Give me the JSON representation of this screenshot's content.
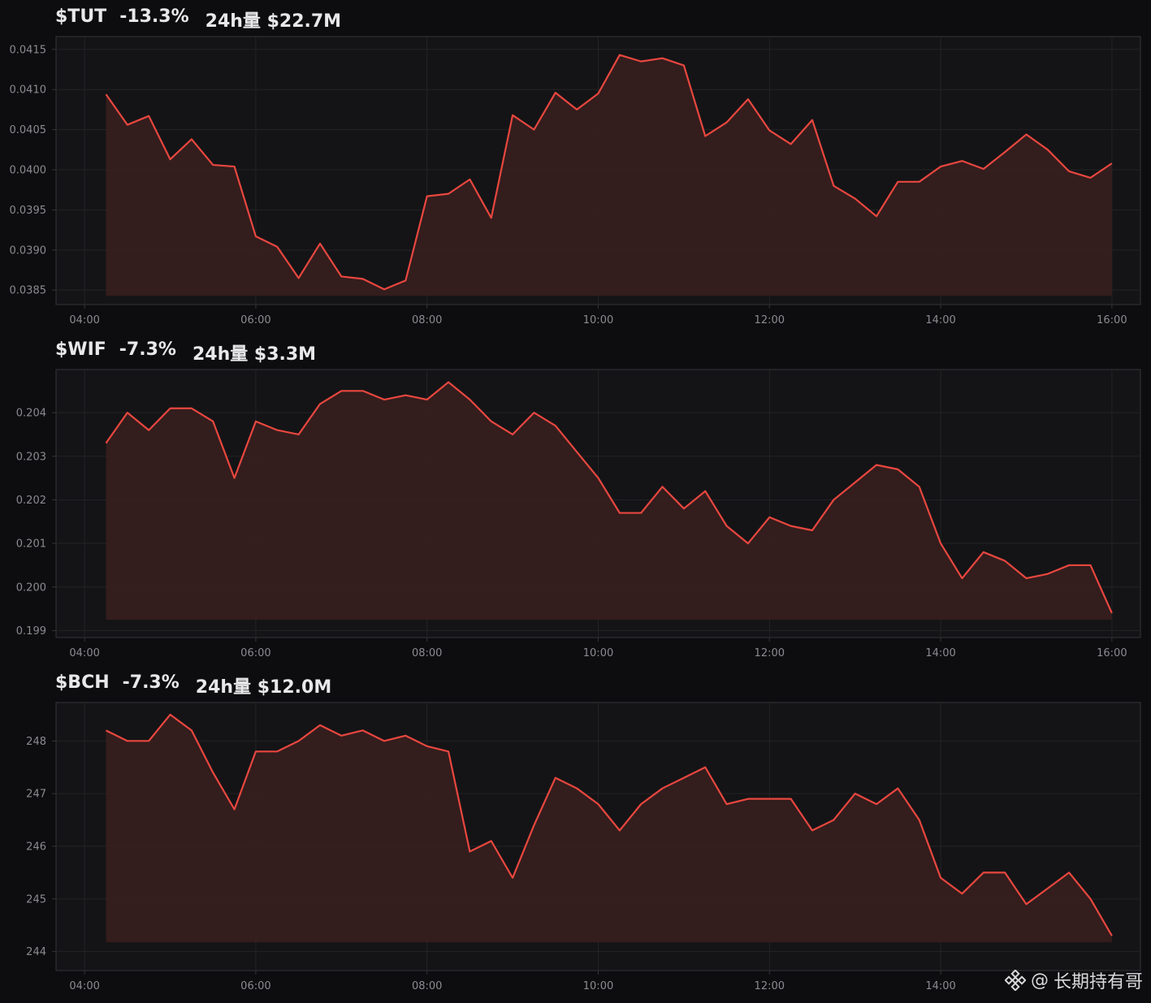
{
  "colors": {
    "line": "#e8473f",
    "fill": "#3a1e1e",
    "plot_bg": "#141416",
    "grid": "#232327",
    "axis": "#35353a",
    "text": "#8b8b90"
  },
  "watermark": {
    "at": "@",
    "text": "长期持有哥",
    "icon": "binance-logo-icon"
  },
  "chart_data": [
    {
      "type": "area",
      "title_symbol": "$TUT",
      "title_change": "-13.3%",
      "title_volume": "24h量 $22.7M",
      "x_ticks": [
        "04:00",
        "06:00",
        "08:00",
        "10:00",
        "12:00",
        "14:00",
        "16:00"
      ],
      "y_ticks": [
        "0.0385",
        "0.0390",
        "0.0395",
        "0.0400",
        "0.0405",
        "0.0410",
        "0.0415"
      ],
      "ylim": [
        0.03832,
        0.04166
      ],
      "xlim": [
        "03:40",
        "16:20"
      ],
      "x": [
        "04:15",
        "04:30",
        "04:45",
        "05:00",
        "05:15",
        "05:30",
        "05:45",
        "06:00",
        "06:15",
        "06:30",
        "06:45",
        "07:00",
        "07:15",
        "07:30",
        "07:45",
        "08:00",
        "08:15",
        "08:30",
        "08:45",
        "09:00",
        "09:15",
        "09:30",
        "09:45",
        "10:00",
        "10:15",
        "10:30",
        "10:45",
        "11:00",
        "11:15",
        "11:30",
        "11:45",
        "12:00",
        "12:15",
        "12:30",
        "12:45",
        "13:00",
        "13:15",
        "13:30",
        "13:45",
        "14:00",
        "14:15",
        "14:30",
        "14:45",
        "15:00",
        "15:15",
        "15:30",
        "15:45",
        "16:00"
      ],
      "values": [
        0.04094,
        0.04056,
        0.04067,
        0.04013,
        0.04038,
        0.04006,
        0.04004,
        0.03917,
        0.03904,
        0.03865,
        0.03908,
        0.03867,
        0.03864,
        0.03851,
        0.03862,
        0.03967,
        0.0397,
        0.03988,
        0.0394,
        0.04068,
        0.0405,
        0.04096,
        0.04075,
        0.04095,
        0.04143,
        0.04135,
        0.04139,
        0.0413,
        0.04042,
        0.04059,
        0.04088,
        0.04049,
        0.04032,
        0.04062,
        0.0398,
        0.03964,
        0.03942,
        0.03985,
        0.03985,
        0.04004,
        0.04011,
        0.04001,
        0.04022,
        0.04044,
        0.04025,
        0.03998,
        0.0399,
        0.04008
      ]
    },
    {
      "type": "area",
      "title_symbol": "$WIF",
      "title_change": "-7.3%",
      "title_volume": "24h量 $3.3M",
      "x_ticks": [
        "04:00",
        "06:00",
        "08:00",
        "10:00",
        "12:00",
        "14:00",
        "16:00"
      ],
      "y_ticks": [
        "0.199",
        "0.200",
        "0.201",
        "0.202",
        "0.203",
        "0.204"
      ],
      "ylim": [
        0.19884,
        0.20499
      ],
      "xlim": [
        "03:40",
        "16:20"
      ],
      "x": [
        "04:15",
        "04:30",
        "04:45",
        "05:00",
        "05:15",
        "05:30",
        "05:45",
        "06:00",
        "06:15",
        "06:30",
        "06:45",
        "07:00",
        "07:15",
        "07:30",
        "07:45",
        "08:00",
        "08:15",
        "08:30",
        "08:45",
        "09:00",
        "09:15",
        "09:30",
        "09:45",
        "10:00",
        "10:15",
        "10:30",
        "10:45",
        "11:00",
        "11:15",
        "11:30",
        "11:45",
        "12:00",
        "12:15",
        "12:30",
        "12:45",
        "13:00",
        "13:15",
        "13:30",
        "13:45",
        "14:00",
        "14:15",
        "14:30",
        "14:45",
        "15:00",
        "15:15",
        "15:30",
        "15:45",
        "16:00"
      ],
      "values": [
        0.2033,
        0.204,
        0.2036,
        0.2041,
        0.2041,
        0.2038,
        0.2025,
        0.2038,
        0.2036,
        0.2035,
        0.2042,
        0.2045,
        0.2045,
        0.2043,
        0.2044,
        0.2043,
        0.2047,
        0.2043,
        0.2038,
        0.2035,
        0.204,
        0.2037,
        0.2031,
        0.2025,
        0.2017,
        0.2017,
        0.2023,
        0.2018,
        0.2022,
        0.2014,
        0.201,
        0.2016,
        0.2014,
        0.2013,
        0.202,
        0.2024,
        0.2028,
        0.2027,
        0.2023,
        0.201,
        0.2002,
        0.2008,
        0.2006,
        0.2002,
        0.2003,
        0.2005,
        0.2005,
        0.1994
      ]
    },
    {
      "type": "area",
      "title_symbol": "$BCH",
      "title_change": "-7.3%",
      "title_volume": "24h量 $12.0M",
      "x_ticks": [
        "04:00",
        "06:00",
        "08:00",
        "10:00",
        "12:00",
        "14:00"
      ],
      "y_ticks": [
        "244",
        "245",
        "246",
        "247",
        "248"
      ],
      "ylim": [
        243.64,
        248.73
      ],
      "xlim": [
        "03:40",
        "16:20"
      ],
      "x": [
        "04:15",
        "04:30",
        "04:45",
        "05:00",
        "05:15",
        "05:30",
        "05:45",
        "06:00",
        "06:15",
        "06:30",
        "06:45",
        "07:00",
        "07:15",
        "07:30",
        "07:45",
        "08:00",
        "08:15",
        "08:30",
        "08:45",
        "09:00",
        "09:15",
        "09:30",
        "09:45",
        "10:00",
        "10:15",
        "10:30",
        "10:45",
        "11:00",
        "11:15",
        "11:30",
        "11:45",
        "12:00",
        "12:15",
        "12:30",
        "12:45",
        "13:00",
        "13:15",
        "13:30",
        "13:45",
        "14:00",
        "14:15",
        "14:30",
        "14:45",
        "15:00",
        "15:15",
        "15:30",
        "15:45",
        "16:00"
      ],
      "values": [
        248.2,
        248.0,
        248.0,
        248.5,
        248.2,
        247.4,
        246.7,
        247.8,
        247.8,
        248.0,
        248.3,
        248.1,
        248.2,
        248.0,
        248.1,
        247.9,
        247.8,
        245.9,
        246.1,
        245.4,
        246.4,
        247.3,
        247.1,
        246.8,
        246.3,
        246.8,
        247.1,
        247.3,
        247.5,
        246.8,
        246.9,
        246.9,
        246.9,
        246.3,
        246.5,
        247.0,
        246.8,
        247.1,
        246.5,
        245.4,
        245.1,
        245.5,
        245.5,
        244.9,
        245.2,
        245.5,
        245.0,
        244.3
      ]
    }
  ]
}
